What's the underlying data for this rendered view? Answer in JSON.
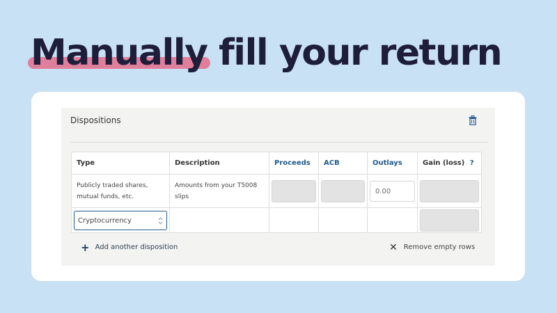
{
  "headline": {
    "highlight": "Manually",
    "rest": " fill your return",
    "highlight_color": "#e07f9c",
    "text_color": "#1e1d3a"
  },
  "panel": {
    "title": "Dispositions",
    "delete_icon": "trash-icon"
  },
  "table": {
    "headers": [
      "Type",
      "Description",
      "Proceeds",
      "ACB",
      "Outlays",
      "Gain (loss)"
    ],
    "help_mark": "?",
    "link_color": "#1e5a8c",
    "rows": [
      {
        "type": "Publicly traded shares, mutual funds, etc.",
        "description": "Amounts from your T5008 slips",
        "outlays": "0.00"
      },
      {
        "type_select": "Cryptocurrency"
      }
    ]
  },
  "actions": {
    "add_icon": "plus-icon",
    "add_label": "Add another disposition",
    "remove_icon": "x-icon",
    "remove_label": "Remove empty rows"
  },
  "colors": {
    "background": "#c8e1f4",
    "card": "#ffffff",
    "panel": "#f3f3f2"
  }
}
